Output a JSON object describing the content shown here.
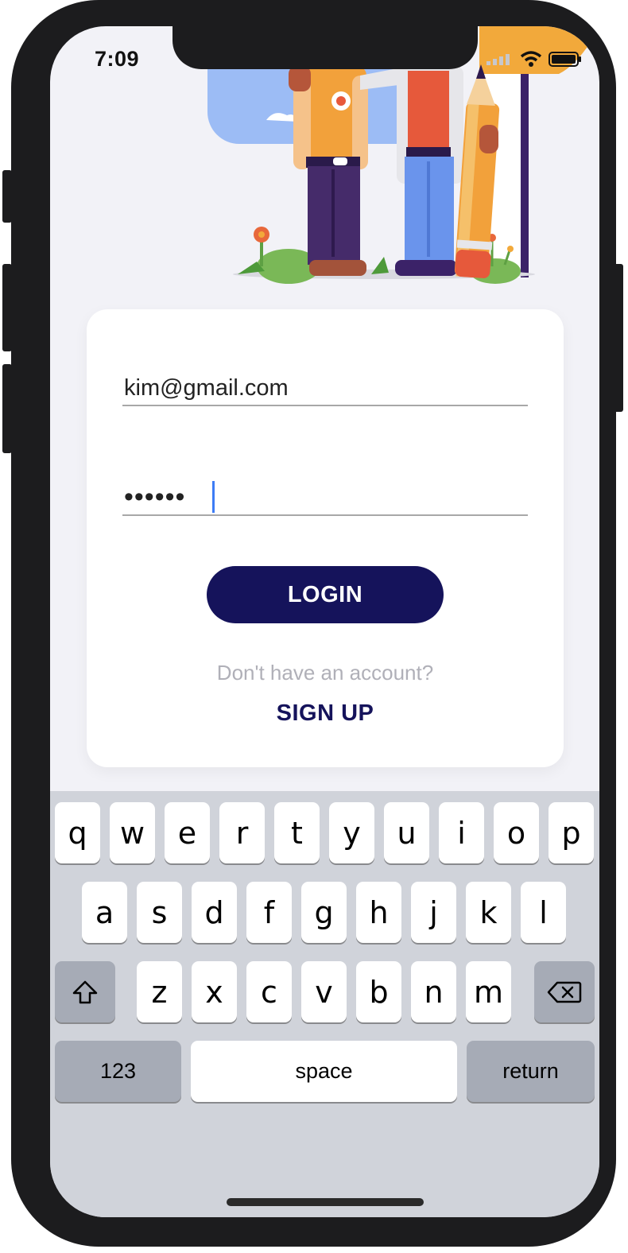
{
  "status_bar": {
    "time": "7:09"
  },
  "login_form": {
    "email_value": "kim@gmail.com",
    "password_value": "••••••",
    "login_label": "LOGIN",
    "no_account_text": "Don't have an account?",
    "signup_label": "SIGN UP"
  },
  "keyboard": {
    "row1": [
      "q",
      "w",
      "e",
      "r",
      "t",
      "y",
      "u",
      "i",
      "o",
      "p"
    ],
    "row2": [
      "a",
      "s",
      "d",
      "f",
      "g",
      "h",
      "j",
      "k",
      "l"
    ],
    "row3": [
      "z",
      "x",
      "c",
      "v",
      "b",
      "n",
      "m"
    ],
    "numbers_label": "123",
    "space_label": "space",
    "return_label": "return"
  },
  "colors": {
    "primary": "#15135b",
    "caret": "#3d7cf5",
    "screen_bg": "#f2f2f7",
    "keyboard_bg": "#d0d3da"
  }
}
